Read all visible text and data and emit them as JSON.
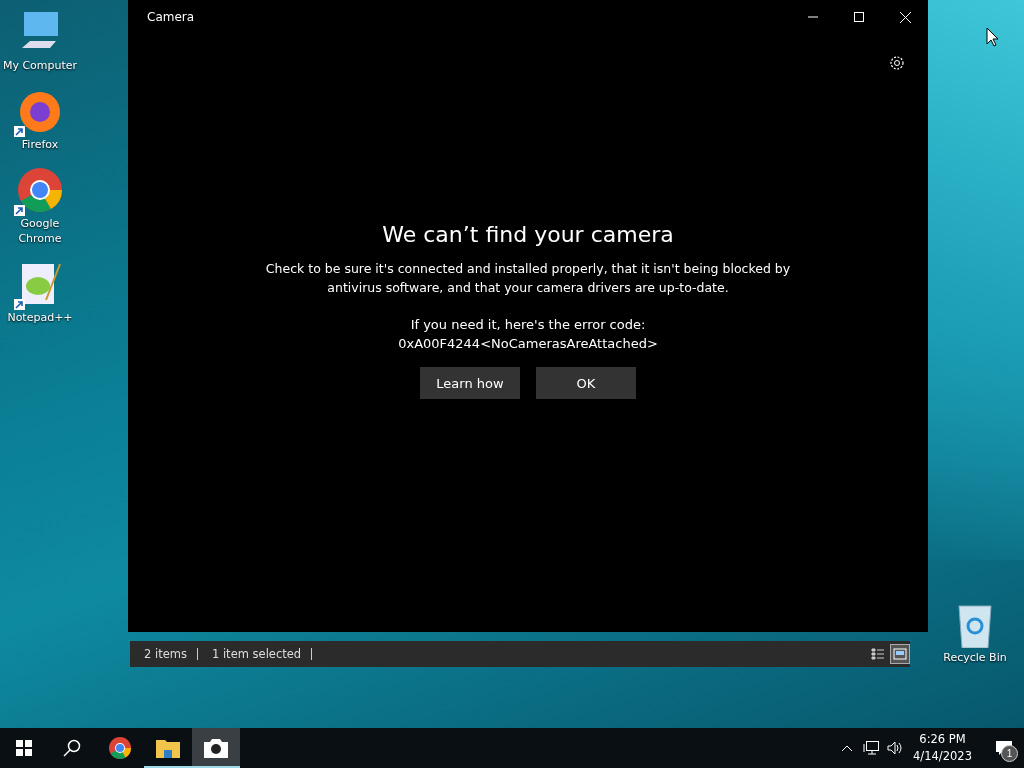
{
  "desktop_icons": [
    {
      "kind": "computer",
      "label": "My Computer",
      "shortcut": false
    },
    {
      "kind": "firefox",
      "label": "Firefox",
      "shortcut": true
    },
    {
      "kind": "chrome",
      "label": "Google Chrome",
      "shortcut": true
    },
    {
      "kind": "notepad",
      "label": "Notepad++",
      "shortcut": true
    }
  ],
  "recycle_bin": {
    "label": "Recycle Bin"
  },
  "explorer_status_bar": {
    "items": [
      "2 items",
      "1 item selected"
    ],
    "views": [
      {
        "kind": "details",
        "selected": false
      },
      {
        "kind": "large-icons",
        "selected": true
      }
    ]
  },
  "window": {
    "title": "Camera"
  },
  "error": {
    "heading": "We can’t find your camera",
    "message": "Check to be sure it's connected and installed properly, that it isn't being blocked by antivirus software, and that your camera drivers are up-to-date.",
    "code_label": "If you need it, here's the error code:",
    "code": "0xA00F4244<NoCamerasAreAttached>",
    "buttons": [
      "Learn how",
      "OK"
    ]
  },
  "taskbar": {
    "apps": [
      {
        "kind": "chrome",
        "running": false,
        "active": false
      },
      {
        "kind": "folder",
        "running": true,
        "active": false
      },
      {
        "kind": "camera",
        "running": true,
        "active": true
      }
    ],
    "time": "6:26 PM",
    "date": "4/14/2023",
    "notification_count": "1"
  }
}
